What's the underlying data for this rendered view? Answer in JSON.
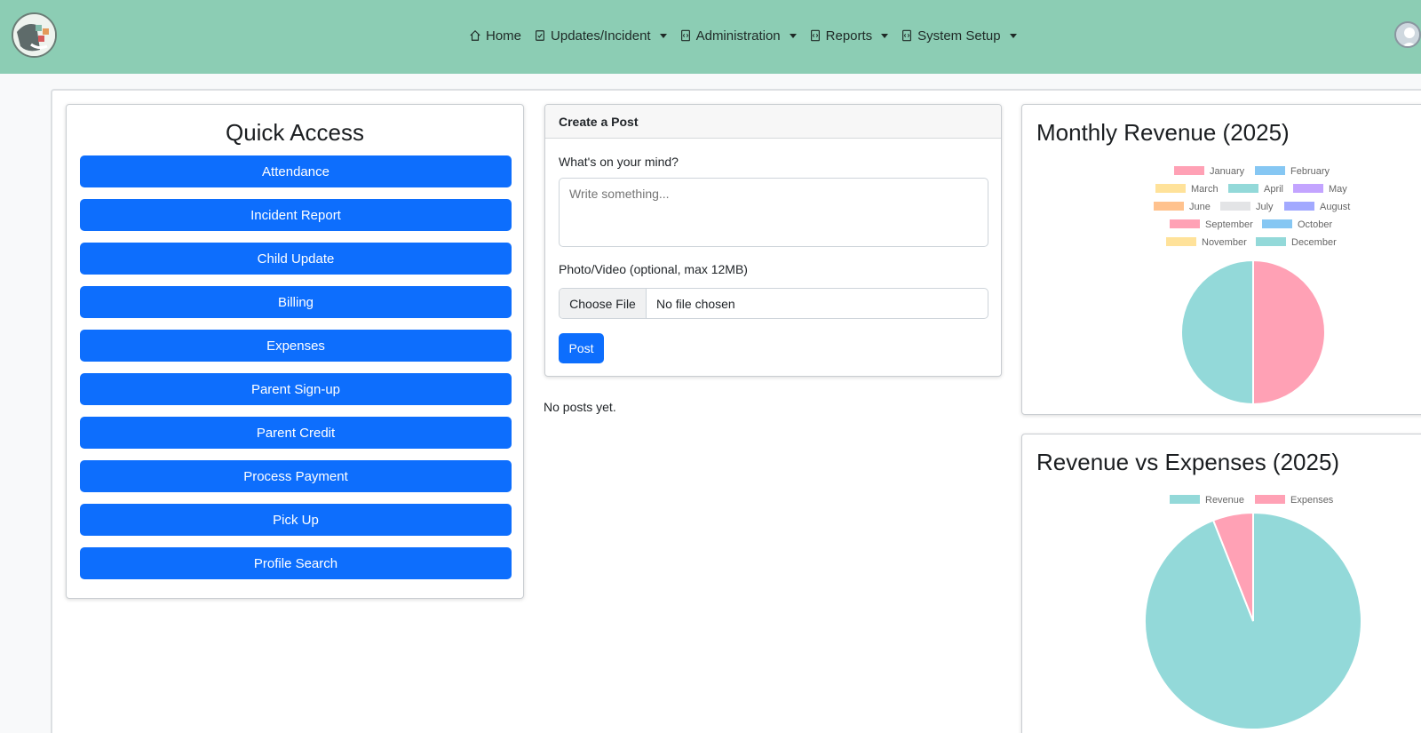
{
  "nav": {
    "items": [
      {
        "label": "Home",
        "icon": "home-icon",
        "dropdown": false
      },
      {
        "label": "Updates/Incident",
        "icon": "clipboard-icon",
        "dropdown": true
      },
      {
        "label": "Administration",
        "icon": "code-file-icon",
        "dropdown": true
      },
      {
        "label": "Reports",
        "icon": "code-file-icon",
        "dropdown": true
      },
      {
        "label": "System Setup",
        "icon": "code-file-icon",
        "dropdown": true
      }
    ],
    "background": "#8ccdb4"
  },
  "quick_access": {
    "title": "Quick Access",
    "buttons": [
      "Attendance",
      "Incident Report",
      "Child Update",
      "Billing",
      "Expenses",
      "Parent Sign-up",
      "Parent Credit",
      "Process Payment",
      "Pick Up",
      "Profile Search"
    ],
    "button_color": "#0d6efd"
  },
  "post": {
    "header": "Create a Post",
    "prompt_label": "What's on your mind?",
    "textarea_placeholder": "Write something...",
    "media_label": "Photo/Video (optional, max 12MB)",
    "choose_file": "Choose File",
    "file_status": "No file chosen",
    "submit": "Post",
    "empty_message": "No posts yet."
  },
  "chart_data": [
    {
      "type": "pie",
      "title": "Monthly Revenue (2025)",
      "legend_position": "top",
      "categories": [
        "January",
        "February",
        "March",
        "April",
        "May",
        "June",
        "July",
        "August",
        "September",
        "October",
        "November",
        "December"
      ],
      "colors": [
        "#ffa1b5",
        "#86c7f3",
        "#ffe29a",
        "#93d9d9",
        "#c3a4ff",
        "#ffc28e",
        "#e3e4e6",
        "#a2a9ff",
        "#ffa1b5",
        "#86c7f3",
        "#ffe29a",
        "#93d9d9"
      ],
      "values": [
        50,
        0,
        0,
        50,
        0,
        0,
        0,
        0,
        0,
        0,
        0,
        0
      ]
    },
    {
      "type": "pie",
      "title": "Revenue vs Expenses (2025)",
      "legend_position": "top",
      "categories": [
        "Revenue",
        "Expenses"
      ],
      "colors": [
        "#93d9d9",
        "#ffa1b5"
      ],
      "values": [
        94,
        6
      ]
    }
  ]
}
